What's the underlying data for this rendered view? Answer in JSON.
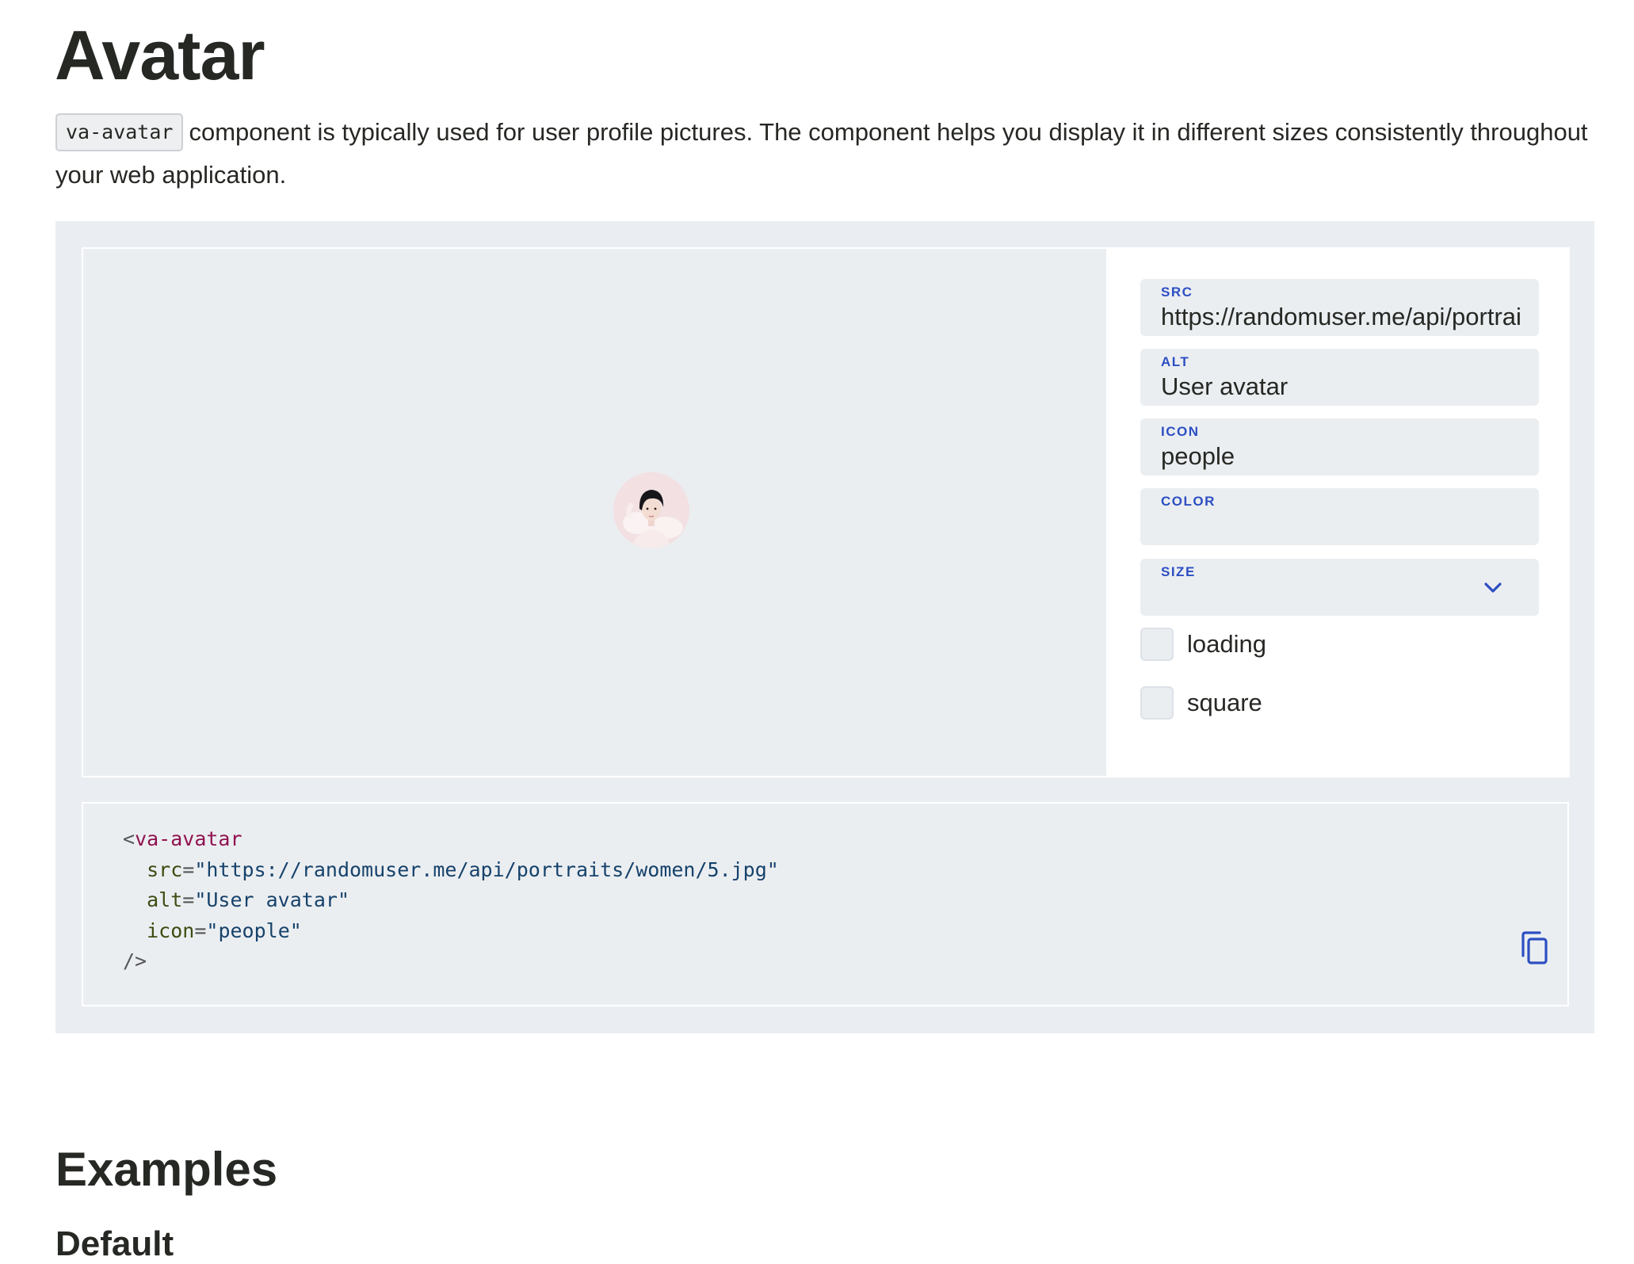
{
  "page": {
    "title": "Avatar",
    "intro_code": "va-avatar",
    "intro_text": "component is typically used for user profile pictures. The component helps you display it in different sizes consistently throughout your web application."
  },
  "controls": {
    "src": {
      "label": "SRC",
      "value": "https://randomuser.me/api/portraits/women/5.jpg"
    },
    "alt": {
      "label": "ALT",
      "value": "User avatar"
    },
    "icon": {
      "label": "ICON",
      "value": "people"
    },
    "color": {
      "label": "COLOR",
      "value": ""
    },
    "size": {
      "label": "SIZE",
      "value": ""
    },
    "loading": {
      "label": "loading",
      "checked": false
    },
    "square": {
      "label": "square",
      "checked": false
    }
  },
  "code": {
    "tag_open": "<",
    "tag_name": "va-avatar",
    "src_attr": "src",
    "src_value": "\"https://randomuser.me/api/portraits/women/5.jpg\"",
    "alt_attr": "alt",
    "alt_value": "\"User avatar\"",
    "icon_attr": "icon",
    "icon_value": "\"people\"",
    "eq": "=",
    "tag_close": "/>"
  },
  "sections": {
    "examples": "Examples",
    "default": "Default"
  },
  "icons": {
    "size_dropdown": "chevron-down-icon",
    "copy": "copy-icon"
  },
  "colors": {
    "accent": "#2d4fc2",
    "playground_bg": "#eaeef2",
    "field_bg": "#ebeef1"
  }
}
